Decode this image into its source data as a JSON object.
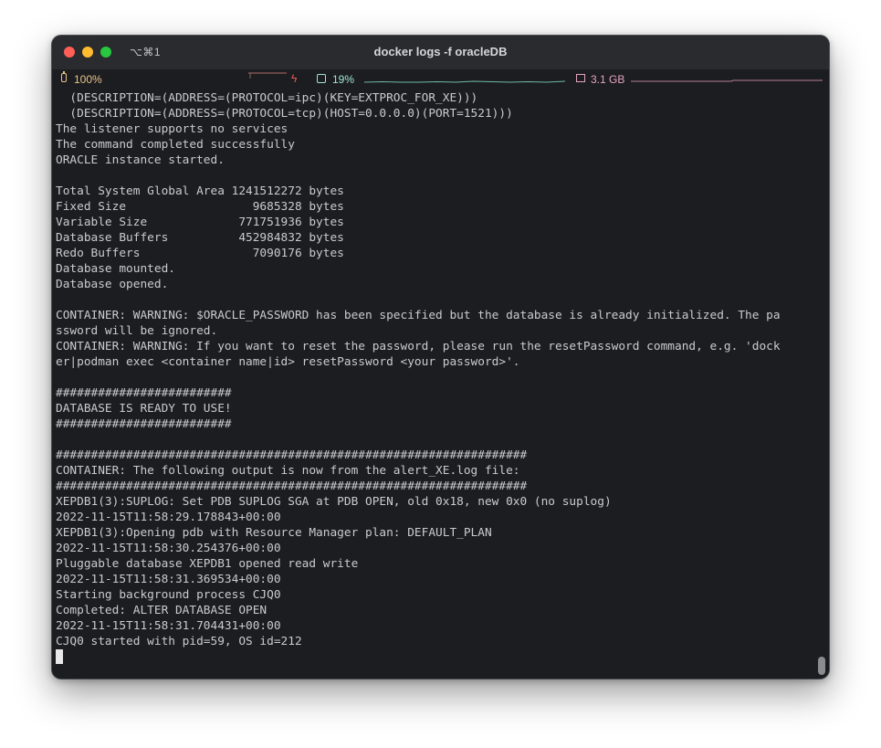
{
  "window": {
    "shortcut": "⌥⌘1",
    "title": "docker logs -f oracleDB"
  },
  "status": {
    "battery_icon": "battery-icon",
    "battery": "100%",
    "battery_color": "#e8c48a",
    "charging_icon": "bolt-icon",
    "charging_glyph": "ϟ",
    "cpu_icon": "chip-icon",
    "cpu": "19%",
    "cpu_color": "#9fe6d4",
    "memory_icon": "memory-icon",
    "memory": "3.1 GB",
    "memory_color": "#e5a3c3"
  },
  "terminal": {
    "lines": [
      "  (DESCRIPTION=(ADDRESS=(PROTOCOL=ipc)(KEY=EXTPROC_FOR_XE)))",
      "  (DESCRIPTION=(ADDRESS=(PROTOCOL=tcp)(HOST=0.0.0.0)(PORT=1521)))",
      "The listener supports no services",
      "The command completed successfully",
      "ORACLE instance started.",
      "",
      "Total System Global Area 1241512272 bytes",
      "Fixed Size                  9685328 bytes",
      "Variable Size             771751936 bytes",
      "Database Buffers          452984832 bytes",
      "Redo Buffers                7090176 bytes",
      "Database mounted.",
      "Database opened.",
      "",
      "CONTAINER: WARNING: $ORACLE_PASSWORD has been specified but the database is already initialized. The pa",
      "ssword will be ignored.",
      "CONTAINER: WARNING: If you want to reset the password, please run the resetPassword command, e.g. 'dock",
      "er|podman exec <container name|id> resetPassword <your password>'.",
      "",
      "#########################",
      "DATABASE IS READY TO USE!",
      "#########################",
      "",
      "###################################################################",
      "CONTAINER: The following output is now from the alert_XE.log file:",
      "###################################################################",
      "XEPDB1(3):SUPLOG: Set PDB SUPLOG SGA at PDB OPEN, old 0x18, new 0x0 (no suplog)",
      "2022-11-15T11:58:29.178843+00:00",
      "XEPDB1(3):Opening pdb with Resource Manager plan: DEFAULT_PLAN",
      "2022-11-15T11:58:30.254376+00:00",
      "Pluggable database XEPDB1 opened read write",
      "2022-11-15T11:58:31.369534+00:00",
      "Starting background process CJQ0",
      "Completed: ALTER DATABASE OPEN",
      "2022-11-15T11:58:31.704431+00:00",
      "CJQ0 started with pid=59, OS id=212"
    ]
  }
}
